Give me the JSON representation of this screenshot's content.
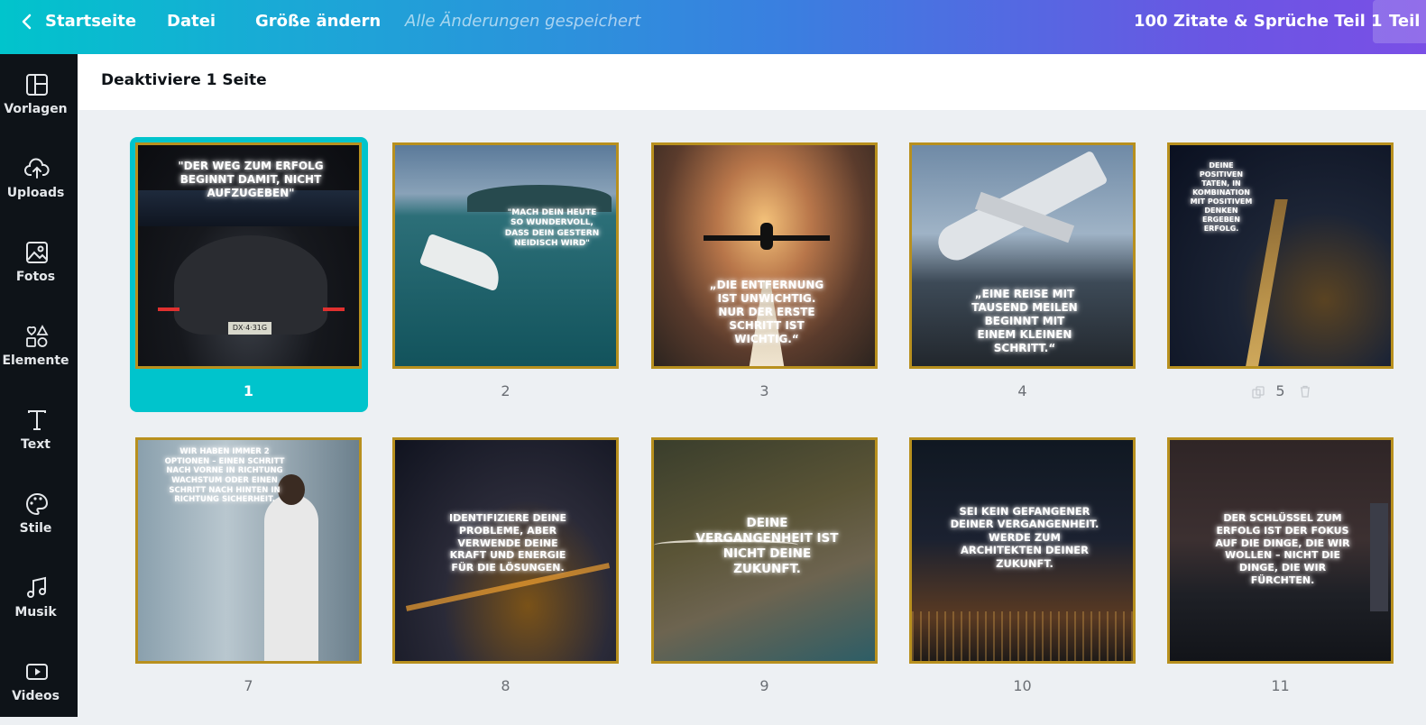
{
  "topbar": {
    "home": "Startseite",
    "file": "Datei",
    "resize": "Größe ändern",
    "saved": "Alle Änderungen gespeichert",
    "doc_title": "100 Zitate & Sprüche Teil 1",
    "share": "Teil"
  },
  "sidebar": {
    "items": [
      {
        "label": "Vorlagen",
        "icon": "templates-icon"
      },
      {
        "label": "Uploads",
        "icon": "upload-icon"
      },
      {
        "label": "Fotos",
        "icon": "photos-icon"
      },
      {
        "label": "Elemente",
        "icon": "elements-icon"
      },
      {
        "label": "Text",
        "icon": "text-icon"
      },
      {
        "label": "Stile",
        "icon": "palette-icon"
      },
      {
        "label": "Musik",
        "icon": "music-icon"
      },
      {
        "label": "Videos",
        "icon": "video-icon"
      }
    ]
  },
  "header": {
    "title": "Deaktiviere 1 Seite"
  },
  "pages": [
    {
      "number": "1",
      "quote": "\"Der Weg zum Erfolg beginnt damit, nicht aufzugeben\"",
      "selected": true
    },
    {
      "number": "2",
      "quote": "\"Mach dein Heute so wundervoll, dass dein Gestern neidisch wird\""
    },
    {
      "number": "3",
      "quote": "„Die Entfernung ist unwichtig. Nur der erste Schritt ist wichtig.“"
    },
    {
      "number": "4",
      "quote": "„Eine Reise mit tausend Meilen beginnt mit einem kleinen Schritt.“"
    },
    {
      "number": "5",
      "quote": "Deine positiven Taten, in Kombination mit positivem Denken ergeben Erfolg."
    },
    {
      "number": "7",
      "quote": "Wir haben immer 2 Optionen – einen Schritt nach vorne in Richtung Wachstum oder einen Schritt nach hinten in Richtung Sicherheit."
    },
    {
      "number": "8",
      "quote": "Identifiziere deine Probleme, aber verwende deine Kraft und Energie für die Lösungen."
    },
    {
      "number": "9",
      "quote": "Deine Vergangenheit ist nicht deine Zukunft."
    },
    {
      "number": "10",
      "quote": "Sei kein Gefangener deiner Vergangenheit. Werde zum Architekten deiner Zukunft."
    },
    {
      "number": "11",
      "quote": "Der Schlüssel zum Erfolg ist der Fokus auf die Dinge, die wir wollen – nicht die Dinge, die wir fürchten."
    }
  ]
}
